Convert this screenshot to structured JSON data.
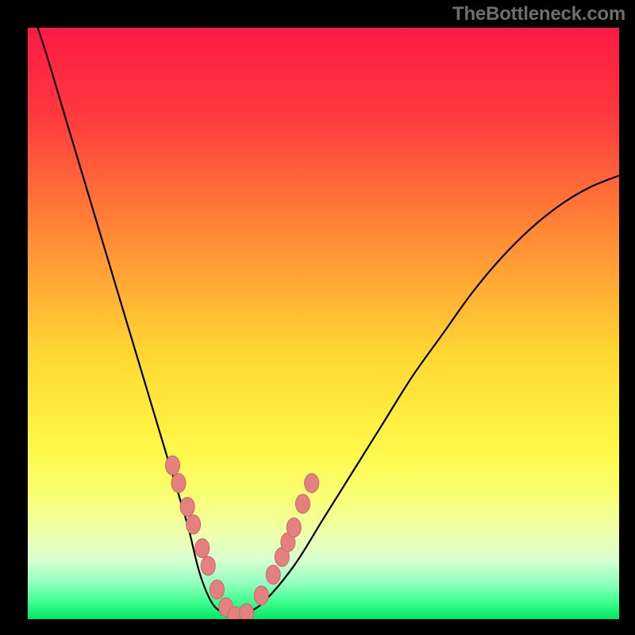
{
  "watermark": "TheBottleneck.com",
  "colors": {
    "frame": "#000000",
    "gradient_stops": [
      {
        "offset": 0.0,
        "color": "#ff1a45"
      },
      {
        "offset": 0.15,
        "color": "#ff3a3e"
      },
      {
        "offset": 0.35,
        "color": "#ff8a36"
      },
      {
        "offset": 0.55,
        "color": "#ffd733"
      },
      {
        "offset": 0.72,
        "color": "#fff94a"
      },
      {
        "offset": 0.8,
        "color": "#f7ff7a"
      },
      {
        "offset": 0.86,
        "color": "#eeffb0"
      },
      {
        "offset": 0.9,
        "color": "#d7ffd0"
      },
      {
        "offset": 0.94,
        "color": "#90ffc0"
      },
      {
        "offset": 0.97,
        "color": "#40ff90"
      },
      {
        "offset": 1.0,
        "color": "#00e765"
      }
    ],
    "curve": "#000000",
    "marker_fill": "#e58080",
    "marker_stroke": "#cc6666"
  },
  "chart_data": {
    "type": "line",
    "title": "",
    "xlabel": "",
    "ylabel": "",
    "xlim": [
      0,
      1
    ],
    "ylim": [
      0,
      1
    ],
    "series": [
      {
        "name": "bottleneck-curve",
        "x": [
          0.0,
          0.03,
          0.06,
          0.09,
          0.12,
          0.15,
          0.18,
          0.21,
          0.24,
          0.27,
          0.29,
          0.31,
          0.33,
          0.35,
          0.37,
          0.4,
          0.45,
          0.5,
          0.55,
          0.6,
          0.65,
          0.7,
          0.75,
          0.8,
          0.85,
          0.9,
          0.95,
          1.0
        ],
        "y": [
          1.05,
          0.96,
          0.86,
          0.76,
          0.66,
          0.56,
          0.46,
          0.36,
          0.26,
          0.16,
          0.08,
          0.03,
          0.01,
          0.0,
          0.01,
          0.03,
          0.09,
          0.17,
          0.25,
          0.33,
          0.41,
          0.48,
          0.55,
          0.61,
          0.66,
          0.7,
          0.73,
          0.75
        ]
      }
    ],
    "markers": {
      "name": "highlighted-points",
      "x": [
        0.245,
        0.255,
        0.27,
        0.28,
        0.295,
        0.305,
        0.32,
        0.335,
        0.35,
        0.37,
        0.395,
        0.415,
        0.43,
        0.44,
        0.45,
        0.465,
        0.48
      ],
      "y": [
        0.26,
        0.23,
        0.19,
        0.16,
        0.12,
        0.09,
        0.05,
        0.02,
        0.005,
        0.01,
        0.04,
        0.075,
        0.105,
        0.13,
        0.155,
        0.195,
        0.23
      ]
    }
  }
}
